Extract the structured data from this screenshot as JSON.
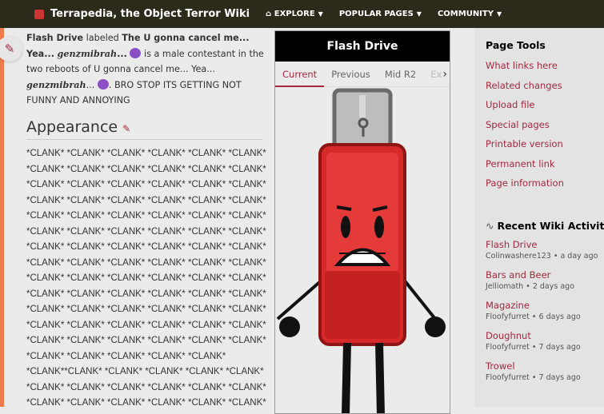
{
  "header": {
    "title": "Terrapedia, the Object Terror Wiki",
    "nav": [
      {
        "label": "EXPLORE"
      },
      {
        "label": "POPULAR PAGES"
      },
      {
        "label": "COMMUNITY"
      }
    ]
  },
  "intro": {
    "name": "Flash Drive",
    "labeled": "labeled",
    "quote": "The U gonna cancel me... Yea...",
    "script_name": "genzmibrah",
    "ellipsis": "...",
    "desc": "is a male contestant in the two reboots of U gonna cancel me... Yea...",
    "tail": ". BRO STOP ITS GETTING NOT FUNNY AND ANNOYING"
  },
  "section": {
    "heading": "Appearance"
  },
  "clank_lines": [
    "*CLANK* *CLANK* *CLANK* *CLANK* *CLANK* *CLANK*",
    "*CLANK* *CLANK* *CLANK* *CLANK* *CLANK* *CLANK*",
    "*CLANK* *CLANK* *CLANK* *CLANK* *CLANK* *CLANK*",
    "*CLANK* *CLANK* *CLANK* *CLANK* *CLANK* *CLANK*",
    "*CLANK* *CLANK* *CLANK* *CLANK* *CLANK* *CLANK*",
    "*CLANK* *CLANK* *CLANK* *CLANK* *CLANK* *CLANK*",
    "*CLANK* *CLANK* *CLANK* *CLANK* *CLANK* *CLANK*",
    "*CLANK* *CLANK* *CLANK* *CLANK* *CLANK* *CLANK*",
    "*CLANK* *CLANK* *CLANK* *CLANK* *CLANK* *CLANK*",
    "*CLANK* *CLANK* *CLANK* *CLANK* *CLANK* *CLANK*",
    "*CLANK* *CLANK* *CLANK* *CLANK* *CLANK* *CLANK*",
    "*CLANK* *CLANK* *CLANK* *CLANK* *CLANK* *CLANK*",
    "*CLANK* *CLANK* *CLANK* *CLANK* *CLANK* *CLANK*",
    "*CLANK* *CLANK* *CLANK* *CLANK* *CLANK*",
    "*CLANK**CLANK* *CLANK* *CLANK* *CLANK* *CLANK*",
    "*CLANK* *CLANK* *CLANK* *CLANK* *CLANK* *CLANK*",
    "*CLANK* *CLANK* *CLANK* *CLANK* *CLANK* *CLANK*"
  ],
  "infobox": {
    "title": "Flash Drive",
    "tabs": [
      "Current",
      "Previous",
      "Mid R2",
      "Ex"
    ]
  },
  "page_tools": {
    "title": "Page Tools",
    "links": [
      "What links here",
      "Related changes",
      "Upload file",
      "Special pages",
      "Printable version",
      "Permanent link",
      "Page information"
    ]
  },
  "recent": {
    "title": "Recent Wiki Activity",
    "items": [
      {
        "page": "Flash Drive",
        "meta": "Colinwashere123 • a day ago"
      },
      {
        "page": "Bars and Beer",
        "meta": "Jelliomath • 2 days ago"
      },
      {
        "page": "Magazine",
        "meta": "Floofyfurret • 6 days ago"
      },
      {
        "page": "Doughnut",
        "meta": "Floofyfurret • 7 days ago"
      },
      {
        "page": "Trowel",
        "meta": "Floofyfurret • 7 days ago"
      }
    ]
  },
  "colors": {
    "accent": "#a3293f",
    "topbar": "#2c2a1a"
  }
}
